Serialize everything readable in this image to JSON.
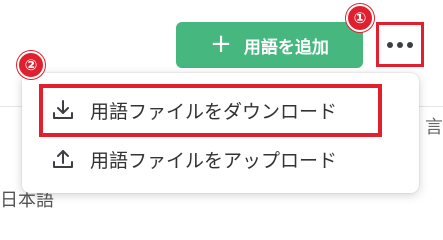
{
  "toolbar": {
    "add_term_label": "用語を追加",
    "add_term_icon": "plus-icon",
    "more_icon": "more-horizontal-icon",
    "add_button_color": "#46b77e"
  },
  "menu": {
    "items": [
      {
        "label": "用語ファイルをダウンロード",
        "icon": "download-icon"
      },
      {
        "label": "用語ファイルをアップロード",
        "icon": "upload-icon"
      }
    ]
  },
  "annotations": {
    "badge_1": "①",
    "badge_2": "②",
    "highlight_color": "#e0202e"
  },
  "background": {
    "partial_header_text": "言",
    "partial_row_text": "日本語"
  }
}
